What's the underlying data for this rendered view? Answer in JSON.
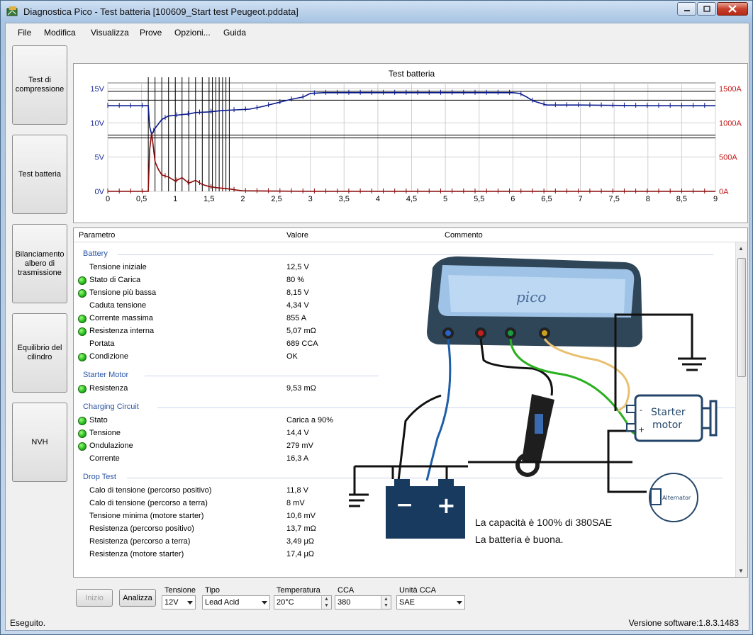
{
  "window": {
    "title": "Diagnostica Pico - Test batteria [100609_Start test Peugeot.pddata]"
  },
  "menu": [
    "File",
    "Modifica",
    "Visualizza",
    "Prove",
    "Opzioni...",
    "Guida"
  ],
  "sidebar": [
    "Test di compressione",
    "Test batteria",
    "Bilanciamento albero di trasmissione",
    "Equilibrio del cilindro",
    "NVH"
  ],
  "chart_data": {
    "type": "line",
    "title": "Test batteria",
    "x_ticks": [
      "0",
      "0,5",
      "1",
      "1,5",
      "2",
      "2,5",
      "3",
      "3,5",
      "4",
      "4,5",
      "5",
      "5,5",
      "6",
      "6,5",
      "7",
      "7,5",
      "8",
      "8,5",
      "9"
    ],
    "y_left_ticks": [
      "15V",
      "10V",
      "5V",
      "0V"
    ],
    "y_right_ticks": [
      "1500A",
      "1000A",
      "500A",
      "0A"
    ],
    "xlim": [
      0,
      9
    ],
    "ylim_left_V": [
      0,
      15
    ],
    "ylim_right_A": [
      0,
      1500
    ],
    "grid": true,
    "series": [
      {
        "color": "#0a1a8c",
        "axis": "left",
        "x": [
          0,
          0.3,
          0.6,
          0.62,
          0.65,
          0.7,
          0.8,
          0.9,
          1.0,
          1.1,
          1.2,
          1.3,
          1.5,
          1.7,
          1.9,
          2.1,
          2.3,
          2.5,
          2.7,
          2.9,
          3.0,
          3.2,
          3.5,
          4.0,
          5.0,
          5.5,
          6.0,
          6.1,
          6.2,
          6.3,
          6.5,
          7.0,
          8.0,
          9.0
        ],
        "values": [
          12.5,
          12.5,
          12.5,
          9.5,
          8.3,
          9.2,
          10.5,
          11.0,
          11.1,
          11.2,
          11.3,
          11.5,
          11.6,
          11.8,
          11.9,
          12.0,
          12.4,
          12.9,
          13.4,
          13.8,
          14.3,
          14.4,
          14.4,
          14.4,
          14.4,
          14.4,
          14.4,
          14.3,
          13.8,
          13.2,
          12.6,
          12.6,
          12.5,
          12.5
        ]
      },
      {
        "color": "#8b0a0a",
        "axis": "right",
        "x": [
          0,
          0.3,
          0.6,
          0.62,
          0.65,
          0.7,
          0.75,
          0.8,
          0.9,
          1.0,
          1.1,
          1.2,
          1.3,
          1.4,
          1.5,
          1.6,
          1.7,
          1.8,
          1.9,
          2.0,
          3.0,
          4.0,
          5.0,
          6.0,
          7.0,
          8.0,
          9.0
        ],
        "values": [
          0,
          0,
          0,
          600,
          855,
          430,
          320,
          240,
          210,
          150,
          200,
          120,
          160,
          100,
          70,
          55,
          45,
          35,
          20,
          8,
          0,
          0,
          0,
          0,
          0,
          0,
          0
        ]
      }
    ],
    "vertical_markers_x": [
      0.6,
      0.7,
      0.8,
      0.9,
      1.0,
      1.1,
      1.2,
      1.3,
      1.4,
      1.5,
      1.55,
      1.6,
      1.65,
      1.7,
      1.75,
      1.8
    ]
  },
  "table": {
    "headers": [
      "Parametro",
      "Valore",
      "Commento"
    ],
    "sections": [
      {
        "title": "Battery",
        "rows": [
          {
            "name": "Tensione iniziale",
            "value": "12,5 V",
            "ok": false
          },
          {
            "name": "Stato di Carica",
            "value": "80 %",
            "ok": true
          },
          {
            "name": "Tensione più bassa",
            "value": "8,15 V",
            "ok": true
          },
          {
            "name": "Caduta tensione",
            "value": "4,34 V",
            "ok": false
          },
          {
            "name": "Corrente massima",
            "value": "855 A",
            "ok": true
          },
          {
            "name": "Resistenza interna",
            "value": "5,07 mΩ",
            "ok": true
          },
          {
            "name": "Portata",
            "value": "689 CCA",
            "ok": false
          },
          {
            "name": "Condizione",
            "value": "OK",
            "ok": true
          }
        ]
      },
      {
        "title": "Starter Motor",
        "rows": [
          {
            "name": "Resistenza",
            "value": "9,53 mΩ",
            "ok": true
          }
        ]
      },
      {
        "title": "Charging Circuit",
        "rows": [
          {
            "name": "Stato",
            "value": "Carica a 90%",
            "ok": true
          },
          {
            "name": "Tensione",
            "value": "14,4 V",
            "ok": true
          },
          {
            "name": "Ondulazione",
            "value": "279 mV",
            "ok": true
          },
          {
            "name": "Corrente",
            "value": "16,3 A",
            "ok": false
          }
        ]
      },
      {
        "title": "Drop Test",
        "rows": [
          {
            "name": "Calo di tensione (percorso positivo)",
            "value": "11,8 V",
            "ok": false
          },
          {
            "name": "Calo di tensione (percorso a terra)",
            "value": "8 mV",
            "ok": false
          },
          {
            "name": "Tensione minima (motore starter)",
            "value": "10,6 mV",
            "ok": false
          },
          {
            "name": "Resistenza (percorso positivo)",
            "value": "13,7 mΩ",
            "ok": false
          },
          {
            "name": "Resistenza (percorso a terra)",
            "value": "3,49 μΩ",
            "ok": false
          },
          {
            "name": "Resistenza (motore starter)",
            "value": "17,4 μΩ",
            "ok": false
          }
        ]
      }
    ]
  },
  "diagram": {
    "device_label": "pico",
    "starter_label_1": "Starter",
    "starter_label_2": "motor",
    "alternator_label": "Alternator",
    "starter_minus": "-",
    "starter_plus": "+",
    "battery_minus": "−",
    "battery_plus": "+",
    "comment_1": "La capacità è 100% di 380SAE",
    "comment_2": "La batteria è buona."
  },
  "controls": {
    "inizio": "Inizio",
    "analizza": "Analizza",
    "tensione_label": "Tensione",
    "tensione_value": "12V",
    "tipo_label": "Tipo",
    "tipo_value": "Lead Acid",
    "temperatura_label": "Temperatura",
    "temperatura_value": "20°C",
    "cca_label": "CCA",
    "cca_value": "380",
    "unita_label": "Unità CCA",
    "unita_value": "SAE"
  },
  "status": {
    "left": "Eseguito.",
    "right": "Versione software:1.8.3.1483"
  }
}
